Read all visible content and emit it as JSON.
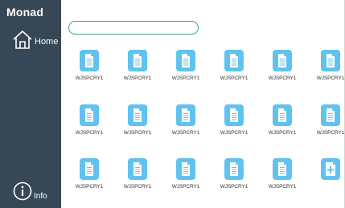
{
  "app": {
    "logo": "Monad"
  },
  "sidebar": {
    "home_label": "Home",
    "info_label": "Info"
  },
  "search": {
    "placeholder": "",
    "value": ""
  },
  "files": [
    {
      "name": "WJSPCRY1"
    },
    {
      "name": "WJSPCRY1"
    },
    {
      "name": "WJSPCRY1"
    },
    {
      "name": "WJSPCRY1"
    },
    {
      "name": "WJSPCRY1"
    },
    {
      "name": "WJSPCRY1"
    },
    {
      "name": "WJSPCRY1"
    },
    {
      "name": "WJSPCRY1"
    },
    {
      "name": "WJSPCRY1"
    },
    {
      "name": "WJSPCRY1"
    },
    {
      "name": "WJSPCRY1"
    },
    {
      "name": "WJSPCRY1"
    },
    {
      "name": "WJSPCRY1"
    },
    {
      "name": "WJSPCRY1"
    },
    {
      "name": "WJSPCRY1"
    },
    {
      "name": "WJSPCRY1"
    },
    {
      "name": "WJSPCRY1"
    }
  ],
  "add_tile": {
    "icon": "add-file-icon"
  },
  "colors": {
    "sidebar": "#364756",
    "search_border": "#3aa57b",
    "file_icon": "#61c3ed"
  }
}
